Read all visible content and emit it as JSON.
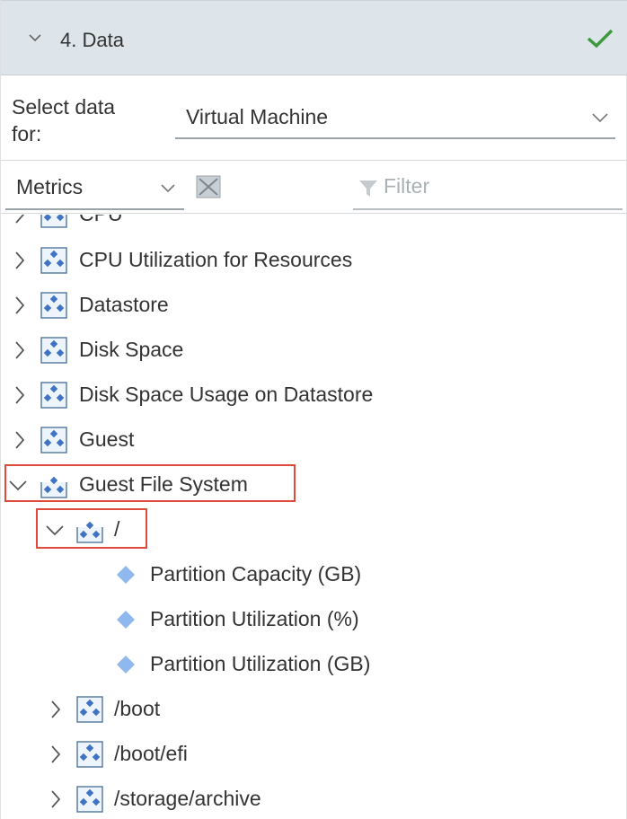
{
  "section": {
    "title": "4. Data"
  },
  "select_data": {
    "label_line1": "Select data",
    "label_line2": "for:",
    "value": "Virtual Machine"
  },
  "toolbar": {
    "metrics_value": "Metrics",
    "filter_placeholder": "Filter"
  },
  "tree": {
    "cpu_partial": "CPU",
    "items": [
      "CPU Utilization for Resources",
      "Datastore",
      "Disk Space",
      "Disk Space Usage on Datastore",
      "Guest",
      "Guest File System"
    ],
    "root_fs": "/",
    "leaves": [
      "Partition Capacity (GB)",
      "Partition Utilization (%)",
      "Partition Utilization (GB)"
    ],
    "subfolders": [
      "/boot",
      "/boot/efi",
      "/storage/archive"
    ]
  },
  "colors": {
    "highlight": "#e04a3a",
    "check": "#3c9a3c",
    "leaf": "#8fb8ee",
    "header_bg": "#dde5ea"
  }
}
